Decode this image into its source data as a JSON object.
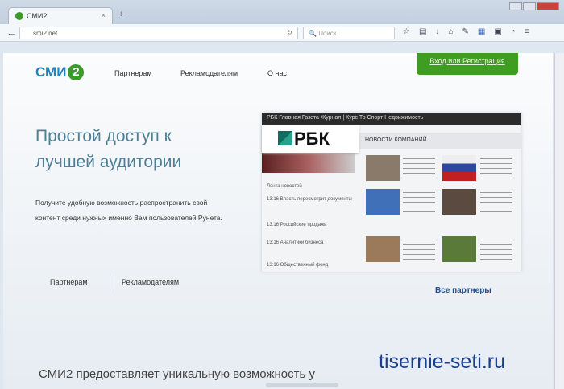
{
  "browser": {
    "tab_title": "СМИ2",
    "url": "smi2.net",
    "search_placeholder": "Поиск"
  },
  "site": {
    "logo": "СМИ",
    "logo_badge": "2",
    "nav": [
      "Партнерам",
      "Рекламодателям",
      "О нас"
    ],
    "login": "Вход или Регистрация",
    "hero_line1": "Простой доступ к",
    "hero_line2": "лучшей аудитории",
    "lead": "Получите удобную возможность распространить свой контент среди нужных именно Вам пользователей Рунета.",
    "btn_partners": "Партнерам",
    "btn_advertisers": "Рекламодателям",
    "all_partners": "Все партнеры",
    "bottom_text": "СМИ2 предоставляет уникальную возможность у"
  },
  "showcase": {
    "brand": "РБК",
    "topbar": "РБК  Главная  Газета  Журнал  |  Курс  Тв  Спорт  Недвижимость",
    "section": "НОВОСТИ КОМПАНИЙ",
    "headlines": [
      "Лента новостей",
      "13:16 Власть пересмотрит документы",
      "13:16 Российские продажи",
      "13:16 Аналитики бизнеса",
      "13:16 Общественный фонд"
    ]
  },
  "watermark": "tisernie-seti.ru"
}
